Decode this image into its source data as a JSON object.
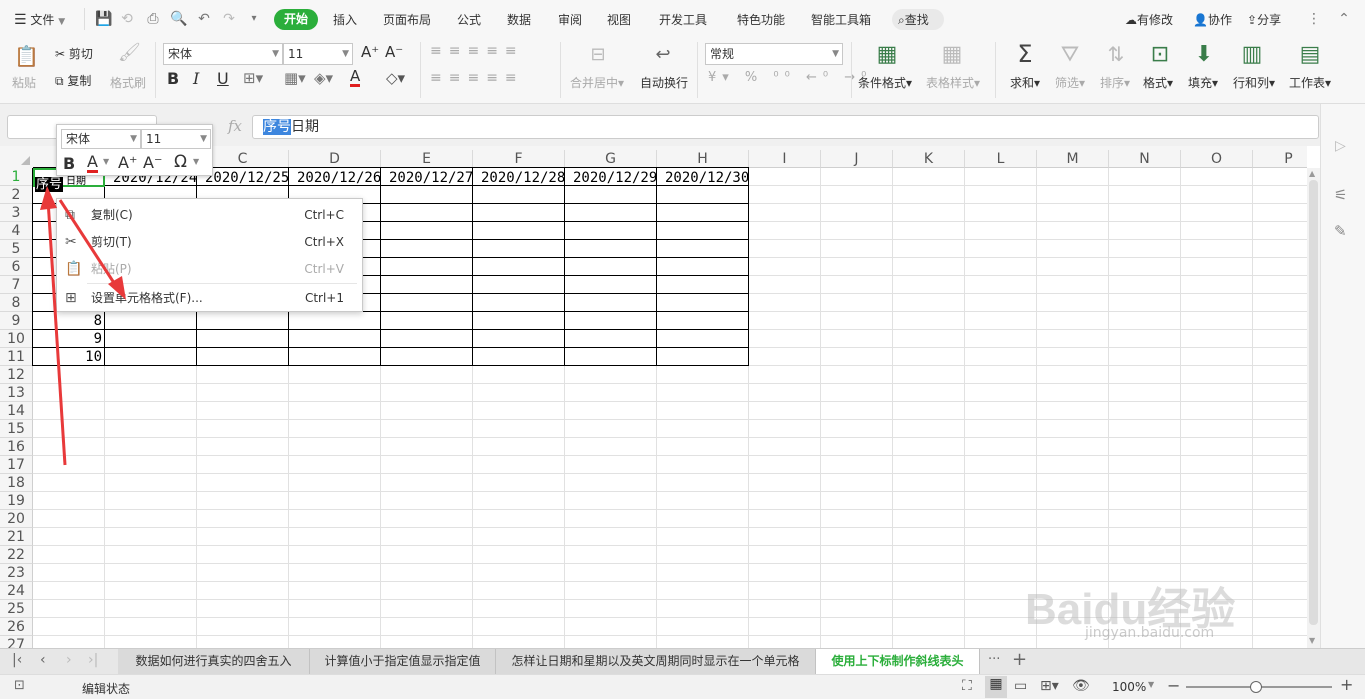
{
  "menubar": {
    "file": "文件",
    "tabs": [
      "开始",
      "插入",
      "页面布局",
      "公式",
      "数据",
      "审阅",
      "视图",
      "开发工具",
      "特色功能",
      "智能工具箱"
    ],
    "search": "查找",
    "right": [
      "有修改",
      "协作",
      "分享"
    ]
  },
  "ribbon": {
    "paste": "粘贴",
    "cut": "剪切",
    "copy": "复制",
    "format_painter": "格式刷",
    "font_name": "宋体",
    "font_size": "11",
    "merge_center": "合并居中",
    "wrap_text": "自动换行",
    "number_format": "常规",
    "conditional_format": "条件格式",
    "table_style": "表格样式",
    "sum": "求和",
    "filter": "筛选",
    "sort": "排序",
    "format": "格式",
    "fill": "填充",
    "row_col": "行和列",
    "worksheet": "工作表"
  },
  "formula_bar": {
    "fx": "fx",
    "selected_text": "序号",
    "rest_text": "日期"
  },
  "grid": {
    "columns": [
      "A",
      "B",
      "C",
      "D",
      "E",
      "F",
      "G",
      "H",
      "I",
      "J",
      "K",
      "L",
      "M",
      "N",
      "O",
      "P"
    ],
    "rows": [
      "1",
      "2",
      "3",
      "4",
      "5",
      "6",
      "7",
      "8",
      "9",
      "10",
      "11",
      "12",
      "13",
      "14",
      "15",
      "16",
      "17",
      "18",
      "19",
      "20",
      "21",
      "22",
      "23",
      "24",
      "25",
      "26",
      "27"
    ],
    "dates": [
      "2020/12/24",
      "2020/12/25",
      "2020/12/26",
      "2020/12/27",
      "2020/12/28",
      "2020/12/29",
      "2020/12/30"
    ],
    "a1_edit": "序号",
    "a1_rest": "日期",
    "a_values": [
      "8",
      "9",
      "10"
    ]
  },
  "mini_toolbar": {
    "font_name": "宋体",
    "font_size": "11"
  },
  "context_menu": {
    "items": [
      {
        "label": "复制(C)",
        "shortcut": "Ctrl+C"
      },
      {
        "label": "剪切(T)",
        "shortcut": "Ctrl+X"
      },
      {
        "label": "粘贴(P)",
        "shortcut": "Ctrl+V"
      },
      {
        "label": "设置单元格格式(F)...",
        "shortcut": "Ctrl+1"
      }
    ]
  },
  "sheet_tabs": {
    "tabs": [
      "数据如何进行真实的四舍五入",
      "计算值小于指定值显示指定值",
      "怎样让日期和星期以及英文周期同时显示在一个单元格",
      "使用上下标制作斜线表头"
    ],
    "more": "···",
    "add": "+"
  },
  "status_bar": {
    "mode": "编辑状态",
    "zoom": "100%"
  },
  "watermark": {
    "brand": "Baidu经验",
    "url": "jingyan.baidu.com"
  },
  "colors": {
    "accent": "#2bae3b",
    "selection": "#3d86de",
    "arrow": "#e8393a"
  }
}
